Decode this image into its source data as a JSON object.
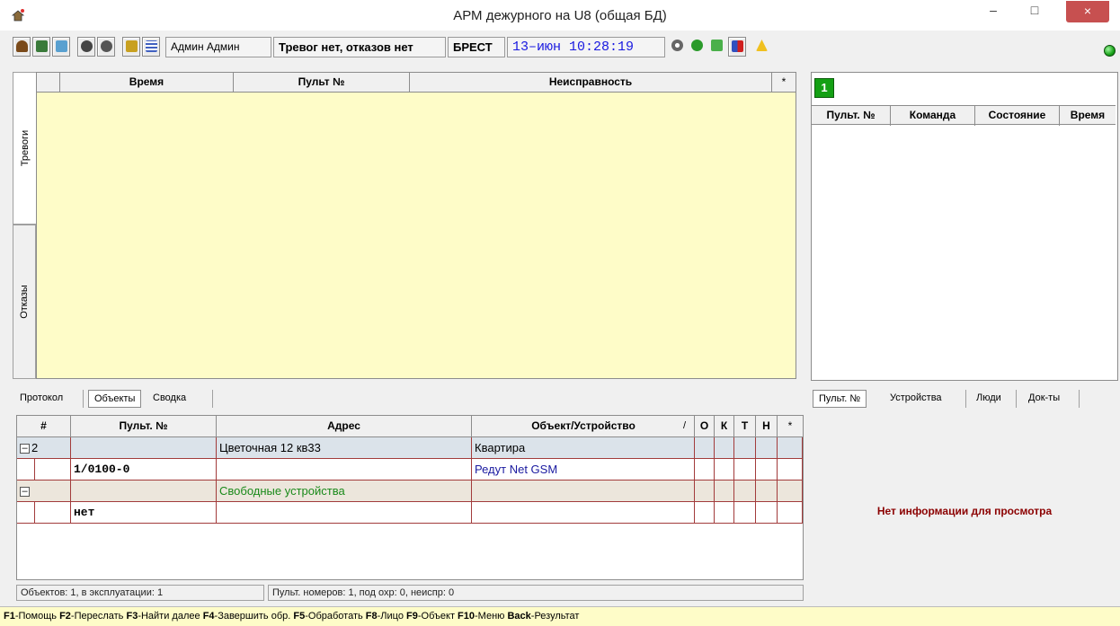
{
  "window": {
    "title": "АРМ дежурного на U8  (общая БД)",
    "minimize": "–",
    "maximize": "□",
    "close": "×"
  },
  "toolbar": {
    "user": "Админ Админ",
    "alarm_status": "Тревог нет, отказов нет",
    "city": "БРЕСТ",
    "datetime": "13–июн 10:28:19"
  },
  "alarms": {
    "vtabs": [
      "Тревоги",
      "Отказы"
    ],
    "columns": [
      "Время",
      "Пульт №",
      "Неисправность",
      "*"
    ]
  },
  "commands": {
    "button": "1",
    "columns": [
      "Пульт. №",
      "Команда",
      "Состояние",
      "Время"
    ]
  },
  "bottom_tabs": [
    "Протокол",
    "Объекты",
    "Сводка"
  ],
  "right_tabs": [
    "Пульт. №",
    "Устройства",
    "Люди",
    "Док-ты"
  ],
  "objects": {
    "columns": [
      "#",
      "Пульт. №",
      "Адрес",
      "Объект/Устройство",
      "/",
      "О",
      "К",
      "Т",
      "Н",
      "*"
    ],
    "rows": [
      {
        "type": "group",
        "expander": "–",
        "num": "2",
        "pult": "",
        "address": "Цветочная 12 кв33",
        "object": "Квартира"
      },
      {
        "type": "plain",
        "expander": "",
        "num": "",
        "pult": "1/0100-0",
        "address": "",
        "object": "Редут Net GSM"
      },
      {
        "type": "free",
        "expander": "–",
        "num": "",
        "pult": "",
        "address": "Свободные устройства",
        "object": ""
      },
      {
        "type": "plain",
        "expander": "",
        "num": "",
        "pult": "нет",
        "address": "",
        "object": ""
      }
    ]
  },
  "status": {
    "objects": "Объектов: 1, в эксплуатации: 1",
    "pults": "Пульт. номеров: 1, под охр: 0, неиспр: 0"
  },
  "info": {
    "empty": "Нет информации для просмотра"
  },
  "hotkeys": [
    {
      "key": "F1",
      "label": "-Помощь"
    },
    {
      "key": "F2",
      "label": "-Переслать"
    },
    {
      "key": "F3",
      "label": "-Найти далее"
    },
    {
      "key": "F4",
      "label": "-Завершить обр."
    },
    {
      "key": "F5",
      "label": "-Обработать"
    },
    {
      "key": "F8",
      "label": "-Лицо"
    },
    {
      "key": "F9",
      "label": "-Объект"
    },
    {
      "key": "F10",
      "label": "-Меню"
    },
    {
      "key": "Back",
      "label": "-Результат"
    }
  ],
  "colors": {
    "grid_bg": "#fefcc8",
    "close_btn": "#c75050",
    "group_row": "#dbe3ea",
    "free_row": "#ece6dc",
    "alert_text": "#8b0000",
    "link_blue": "#1a1aa0",
    "free_green": "#1a8a1a"
  }
}
